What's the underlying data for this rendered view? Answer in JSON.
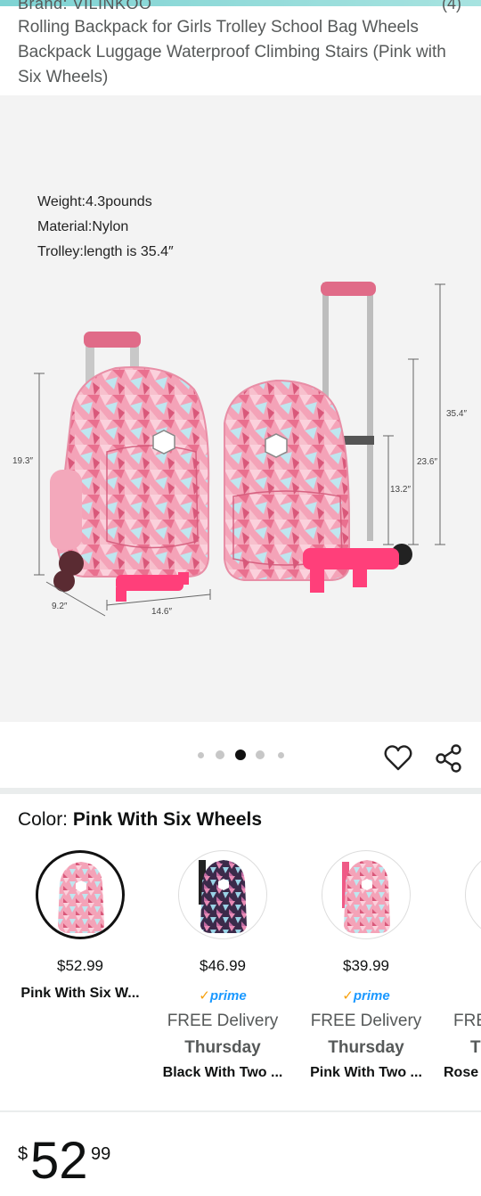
{
  "header": {
    "brand_partial": "Brand: VILINKOO",
    "rating_partial": "(4)",
    "title": "Rolling Backpack for Girls Trolley School Bag Wheels Backpack Luggage Waterproof Climbing Stairs (Pink with Six Wheels)"
  },
  "image": {
    "specs": [
      "Weight:4.3pounds",
      "Material:Nylon",
      "Trolley:length is 35.4″"
    ],
    "dimensions": {
      "height_left": "19.3″",
      "depth": "9.2″",
      "width": "14.6″",
      "total": "35.4″",
      "mid": "23.6″",
      "low": "13.2″"
    }
  },
  "carousel": {
    "count": 5,
    "active_index": 2
  },
  "color": {
    "label": "Color: ",
    "selected": "Pink With Six Wheels"
  },
  "swatches": [
    {
      "price": "$52.99",
      "name": "Pink With Six W...",
      "selected": true,
      "prime": "",
      "delivery": "",
      "day": ""
    },
    {
      "price": "$46.99",
      "name": "Black With Two ...",
      "selected": false,
      "prime": "prime",
      "delivery": "FREE Delivery",
      "day": "Thursday"
    },
    {
      "price": "$39.99",
      "name": "Pink With Two ...",
      "selected": false,
      "prime": "prime",
      "delivery": "FREE Delivery",
      "day": "Thursday"
    },
    {
      "price": "",
      "name": "Rose",
      "selected": false,
      "prime": "",
      "delivery": "FRE",
      "day": "T"
    }
  ],
  "price": {
    "symbol": "$",
    "whole": "52",
    "fraction": "99"
  },
  "colors": {
    "accent": "#1a98ff",
    "pink": "#f27aa0",
    "handle": "#ff3f7a"
  }
}
